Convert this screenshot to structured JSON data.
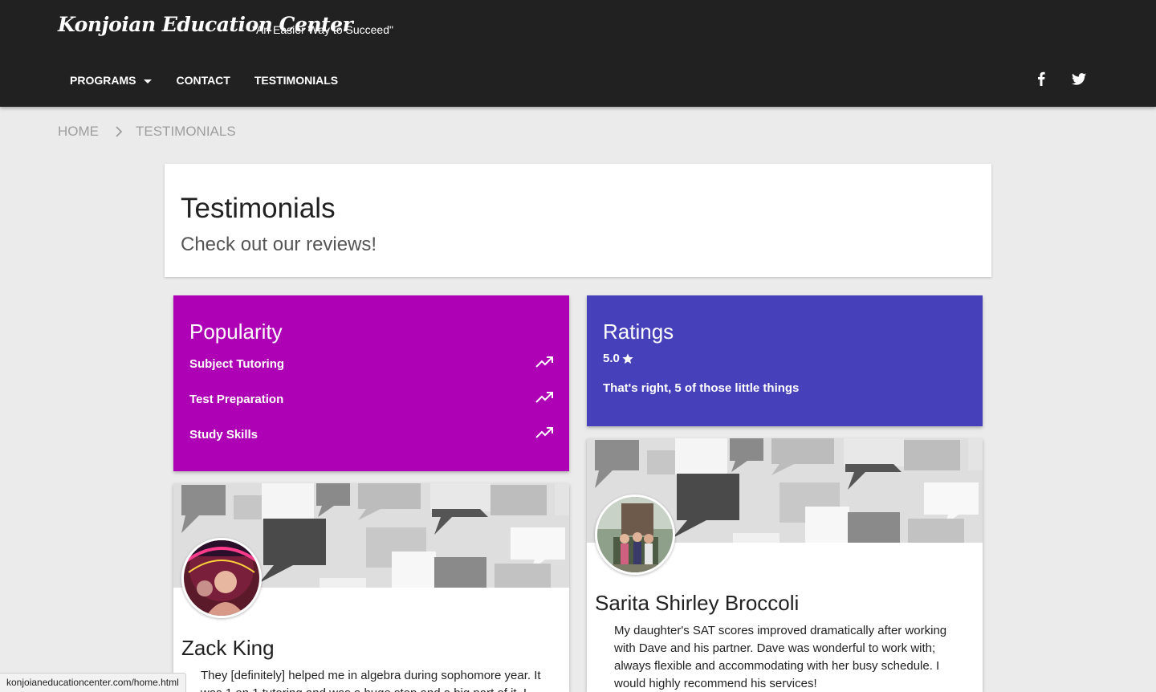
{
  "header": {
    "brand": "Konjoian Education Center",
    "tagline": "\"An Easier Way to Succeed\"",
    "nav": {
      "programs": "PROGRAMS",
      "contact": "CONTACT",
      "testimonials": "TESTIMONIALS"
    },
    "social": [
      "facebook-icon",
      "twitter-icon"
    ]
  },
  "breadcrumb": {
    "home": "HOME",
    "current": "TESTIMONIALS"
  },
  "title_card": {
    "title": "Testimonials",
    "subtitle": "Check out our reviews!"
  },
  "popularity": {
    "title": "Popularity",
    "color": "#ae00b4",
    "items": [
      {
        "label": "Subject Tutoring",
        "icon": "trending-up-icon"
      },
      {
        "label": "Test Preparation",
        "icon": "trending-up-icon"
      },
      {
        "label": "Study Skills",
        "icon": "trending-up-icon"
      }
    ]
  },
  "ratings": {
    "title": "Ratings",
    "color": "#4740bb",
    "value": "5.0",
    "icon": "star-icon",
    "text": "That's right, 5 of those little things"
  },
  "testimonials": [
    {
      "name": "Zack King",
      "text": "They [definitely] helped me in algebra during sophomore year. It was 1 on 1 tutoring and was a huge step and a big part of it. I"
    },
    {
      "name": "Sarita Shirley Broccoli",
      "text": "My daughter's SAT scores improved dramatically after working with Dave and his partner. Dave was wonderful to work with; always flexible and accommodating with her busy schedule. I would highly recommend his services!"
    }
  ],
  "status_bar": {
    "url": "konjoianeducationcenter.com/home.html"
  }
}
